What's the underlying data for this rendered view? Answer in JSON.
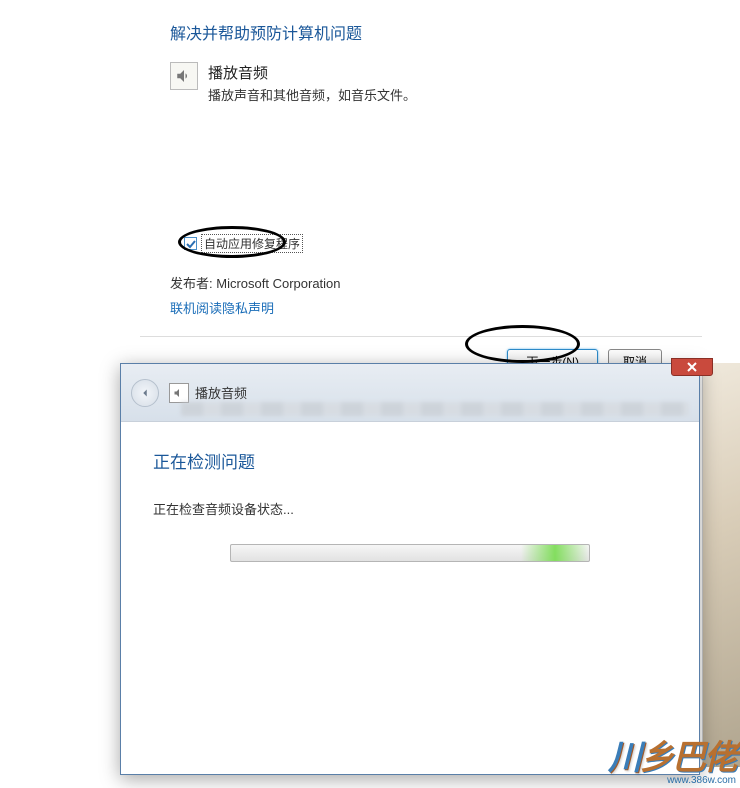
{
  "top": {
    "header": "解决并帮助预防计算机问题",
    "item": {
      "icon": "speaker-icon",
      "title": "播放音频",
      "desc": "播放声音和其他音频，如音乐文件。"
    },
    "checkbox_label": "自动应用修复程序",
    "checkbox_checked": true,
    "publisher_label": "发布者:",
    "publisher_value": "Microsoft Corporation",
    "privacy_link": "联机阅读隐私声明",
    "buttons": {
      "next": "下一步(N)",
      "cancel": "取消"
    }
  },
  "second": {
    "title_icon": "speaker-icon",
    "title": "播放音频",
    "heading": "正在检测问题",
    "status": "正在检查音频设备状态...",
    "progress_indeterminate": true
  },
  "watermark": {
    "url": "www.386w.com"
  }
}
